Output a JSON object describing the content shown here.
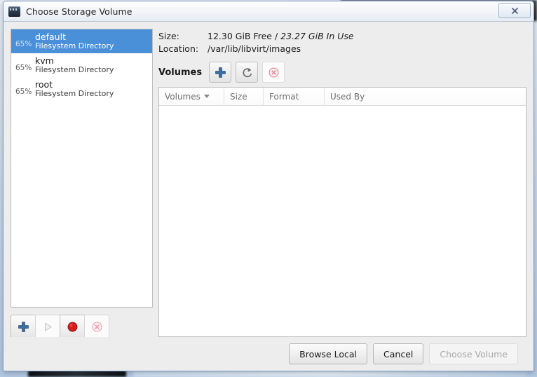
{
  "window": {
    "title": "Choose Storage Volume",
    "icon": "virt-manager-icon",
    "close_label": "✕"
  },
  "pools": {
    "items": [
      {
        "percent": "65%",
        "name": "default",
        "type": "Filesystem Directory",
        "selected": true
      },
      {
        "percent": "65%",
        "name": "kvm",
        "type": "Filesystem Directory",
        "selected": false
      },
      {
        "percent": "65%",
        "name": "root",
        "type": "Filesystem Directory",
        "selected": false
      }
    ],
    "toolbar": [
      {
        "icon": "add-pool-icon",
        "name": "add-pool-button",
        "enabled": true
      },
      {
        "icon": "start-pool-icon",
        "name": "start-pool-button",
        "enabled": false
      },
      {
        "icon": "stop-pool-icon",
        "name": "stop-pool-button",
        "enabled": true
      },
      {
        "icon": "delete-pool-icon",
        "name": "delete-pool-button",
        "enabled": false
      }
    ]
  },
  "details": {
    "size_label": "Size:",
    "size_free": "12.30 GiB Free",
    "size_separator": " / ",
    "size_inuse": "23.27 GiB In Use",
    "location_label": "Location:",
    "location_value": "/var/lib/libvirt/images"
  },
  "volumes": {
    "title": "Volumes",
    "toolbar": [
      {
        "icon": "add-volume-icon",
        "name": "add-volume-button",
        "enabled": true
      },
      {
        "icon": "refresh-volumes-icon",
        "name": "refresh-volumes-button",
        "enabled": true
      },
      {
        "icon": "delete-volume-icon",
        "name": "delete-volume-button",
        "enabled": false
      }
    ],
    "columns": [
      {
        "label": "Volumes",
        "sorted": true
      },
      {
        "label": "Size",
        "sorted": false
      },
      {
        "label": "Format",
        "sorted": false
      },
      {
        "label": "Used By",
        "sorted": false
      }
    ],
    "rows": []
  },
  "footer": {
    "browse_local": "Browse Local",
    "cancel": "Cancel",
    "choose_volume": "Choose Volume"
  },
  "colors": {
    "selection_blue": "#4a90d9",
    "dialog_bg": "#ededed",
    "accent_red": "#cc3333",
    "accent_blue": "#3a6ea5"
  }
}
